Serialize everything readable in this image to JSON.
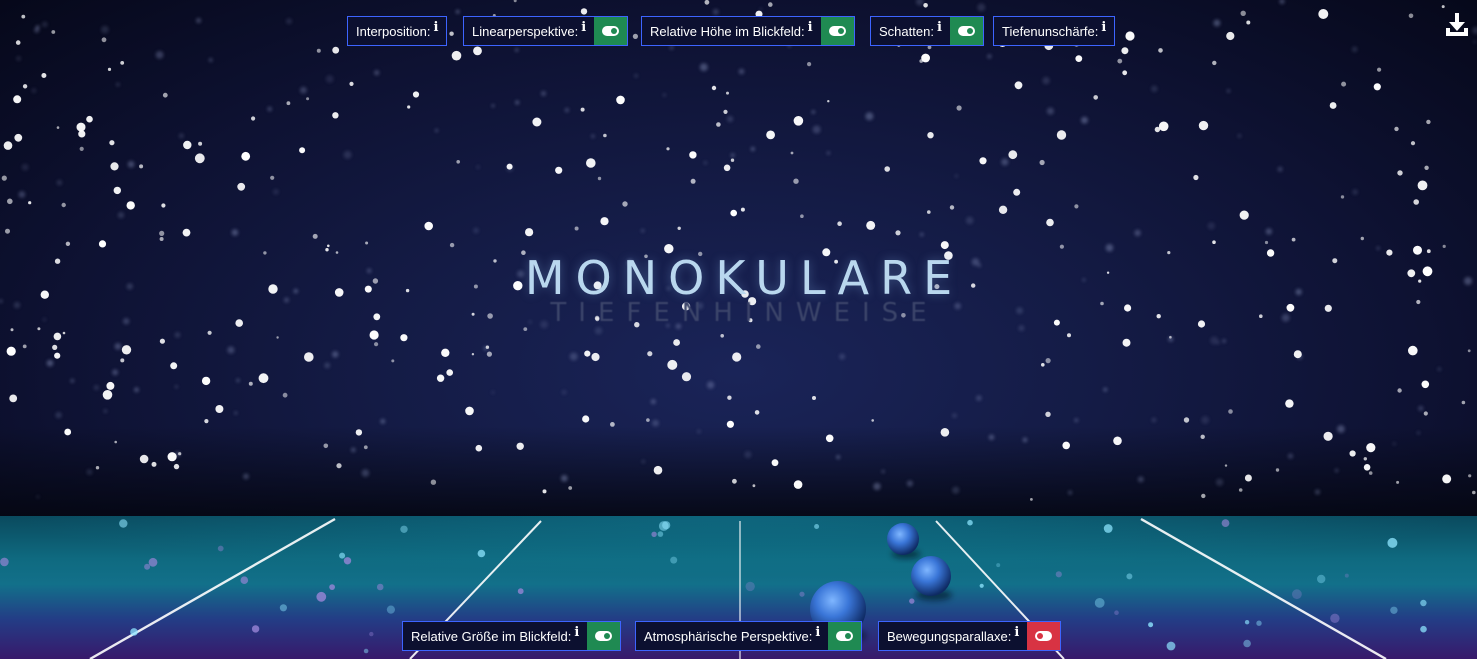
{
  "title": "MONOKULARE",
  "subtitle": "TIEFENHINWEISE",
  "info_glyph": "i",
  "top_controls": [
    {
      "label": "Interposition:",
      "toggle": null
    },
    {
      "label": "Linearperspektive:",
      "toggle": "on"
    },
    {
      "label": "Relative Höhe im Blickfeld:",
      "toggle": "on"
    },
    {
      "label": "Schatten:",
      "toggle": "on"
    },
    {
      "label": "Tiefenunschärfe:",
      "toggle": null
    }
  ],
  "bottom_controls": [
    {
      "label": "Relative Größe im Blickfeld:",
      "toggle": "on"
    },
    {
      "label": "Atmosphärische Perspektive:",
      "toggle": "on"
    },
    {
      "label": "Bewegungsparallaxe:",
      "toggle": "off"
    }
  ],
  "download_icon": "download-icon",
  "colors": {
    "toggle_on": "#1f8a52",
    "toggle_off": "#d83343",
    "control_border": "#3d64ff",
    "control_bg": "#0c1030",
    "title": "#b9d7ee",
    "subtitle": "#3c456a"
  }
}
